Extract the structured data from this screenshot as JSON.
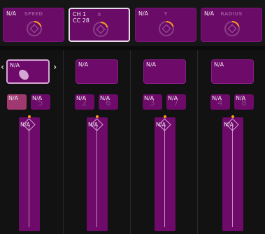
{
  "knobs": [
    {
      "value": "N/A",
      "name": "SPEED",
      "selected": false
    },
    {
      "value": "CH 1\nCC 28",
      "name": "X",
      "selected": true
    },
    {
      "value": "N/A",
      "name": "Y",
      "selected": false
    },
    {
      "value": "N/A",
      "name": "RADIUS",
      "selected": false
    }
  ],
  "strips": [
    {
      "pad": {
        "value": "N/A"
      },
      "nav": {
        "prev": "‹",
        "next": "›"
      },
      "buttons": [
        {
          "value": "N/A",
          "number": "1",
          "on": true
        },
        {
          "value": "N/A",
          "number": "5",
          "on": false
        }
      ],
      "fader": {
        "value": "N/A"
      }
    },
    {
      "pad": {
        "value": "N/A"
      },
      "buttons": [
        {
          "value": "N/A",
          "number": "2",
          "on": false
        },
        {
          "value": "N/A",
          "number": "6",
          "on": false
        }
      ],
      "fader": {
        "value": "N/A"
      }
    },
    {
      "pad": {
        "value": "N/A"
      },
      "buttons": [
        {
          "value": "N/A",
          "number": "3",
          "on": false
        },
        {
          "value": "N/A",
          "number": "7",
          "on": false
        }
      ],
      "fader": {
        "value": "N/A"
      }
    },
    {
      "pad": {
        "value": "N/A"
      },
      "buttons": [
        {
          "value": "N/A",
          "number": "4",
          "on": false
        },
        {
          "value": "N/A",
          "number": "8",
          "on": false
        }
      ],
      "fader": {
        "value": "N/A"
      }
    }
  ],
  "colors": {
    "control": "#6d0a6a",
    "active_button": "#a1386f",
    "indicator": "#ff9a1c"
  }
}
